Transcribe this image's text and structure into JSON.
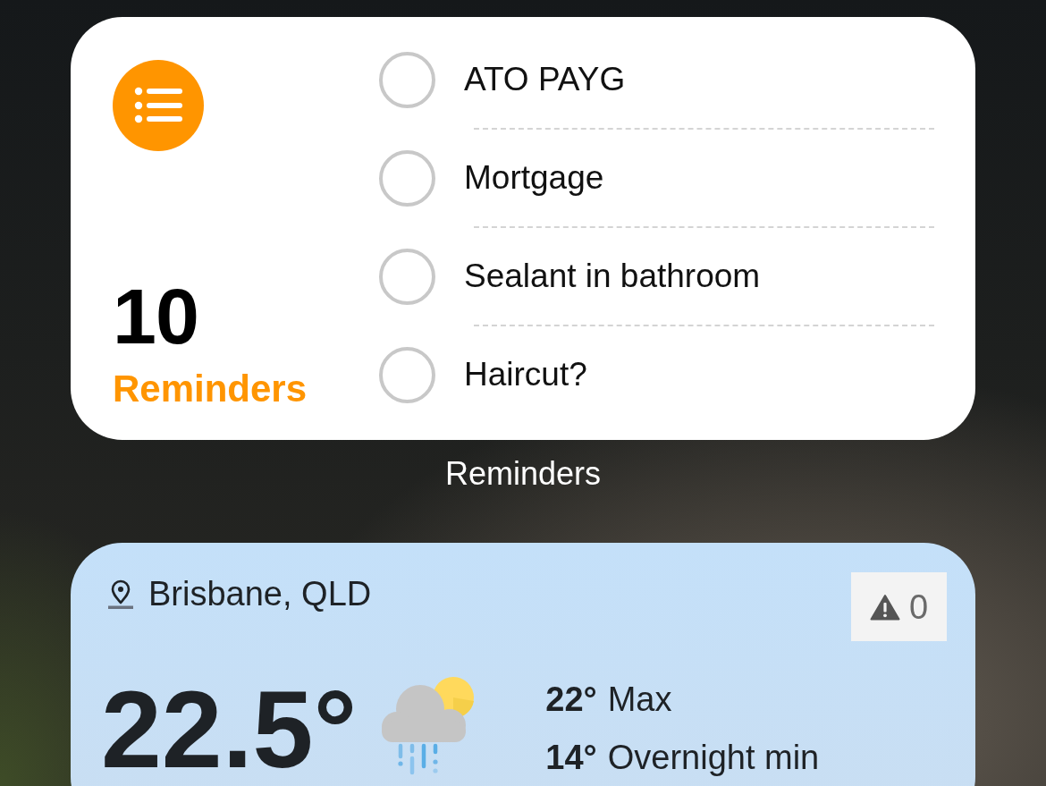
{
  "reminders_widget": {
    "count": "10",
    "list_name": "Reminders",
    "items": [
      {
        "title": "ATO PAYG",
        "checked": false
      },
      {
        "title": "Mortgage",
        "checked": false
      },
      {
        "title": "Sealant in bathroom",
        "checked": false
      },
      {
        "title": "Haircut?",
        "checked": false
      }
    ]
  },
  "widget_label": "Reminders",
  "weather_widget": {
    "location": "Brisbane, QLD",
    "warnings": "0",
    "temperature": "22.5°",
    "forecast": [
      {
        "value": "22°",
        "label": "Max"
      },
      {
        "value": "14°",
        "label": "Overnight min"
      }
    ]
  }
}
